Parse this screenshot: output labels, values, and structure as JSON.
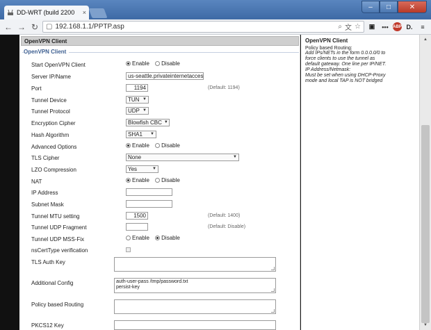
{
  "browser": {
    "tab_title": "DD-WRT (build 2200",
    "tab_close": "×",
    "url": "192.168.⁲1.1/PPTP.asp",
    "back": "←",
    "forward": "→",
    "reload": "↻",
    "win_min": "–",
    "win_max": "□",
    "win_close": "✕",
    "ext_abp": "ABP",
    "ext_d": "D.",
    "menu": "≡"
  },
  "section": {
    "header": "OpenVPN Client",
    "legend": "OpenVPN Client"
  },
  "fields": {
    "start": {
      "label": "Start OpenVPN Client",
      "opt1": "Enable",
      "opt2": "Disable",
      "selected": "Enable"
    },
    "server": {
      "label": "Server IP/Name",
      "value": "us-seattle.privateinternetaccess.c"
    },
    "port": {
      "label": "Port",
      "value": "1194",
      "hint": "(Default: 1194)"
    },
    "tunnel_device": {
      "label": "Tunnel Device",
      "value": "TUN"
    },
    "tunnel_protocol": {
      "label": "Tunnel Protocol",
      "value": "UDP"
    },
    "cipher": {
      "label": "Encryption Cipher",
      "value": "Blowfish CBC"
    },
    "hash": {
      "label": "Hash Algorithm",
      "value": "SHA1"
    },
    "advanced": {
      "label": "Advanced Options",
      "opt1": "Enable",
      "opt2": "Disable",
      "selected": "Enable"
    },
    "tls_cipher": {
      "label": "TLS Cipher",
      "value": "None"
    },
    "lzo": {
      "label": "LZO Compression",
      "value": "Yes"
    },
    "nat": {
      "label": "NAT",
      "opt1": "Enable",
      "opt2": "Disable",
      "selected": "Enable"
    },
    "ip": {
      "label": "IP Address",
      "value": ""
    },
    "subnet": {
      "label": "Subnet Mask",
      "value": ""
    },
    "mtu": {
      "label": "Tunnel MTU setting",
      "value": "1500",
      "hint": "(Default: 1400)"
    },
    "fragment": {
      "label": "Tunnel UDP Fragment",
      "value": "",
      "hint": "(Default: Disable)"
    },
    "mssfix": {
      "label": "Tunnel UDP MSS-Fix",
      "opt1": "Enable",
      "opt2": "Disable",
      "selected": "Disable"
    },
    "nscert": {
      "label": "nsCertType verification"
    },
    "tls_auth": {
      "label": "TLS Auth Key",
      "value": ""
    },
    "additional": {
      "label": "Additional Config",
      "line1": "auth-user-pass /tmp/password.txt",
      "line2": "persist-key"
    },
    "policy": {
      "label": "Policy based Routing",
      "value": ""
    },
    "pkcs12": {
      "label": "PKCS12 Key",
      "value": ""
    }
  },
  "help": {
    "title": "OpenVPN Client",
    "subtitle": "Policy based Routing:",
    "line1": "Add IPs/NETs in the form 0.0.0.0/0 to",
    "line2": "force clients to use the tunnel as",
    "line3": "default gateway. One line per IP/NET.",
    "line4": "IP Address/Netmask:",
    "line5": "Must be set when using DHCP-Proxy",
    "line6": "mode and local TAP is NOT bridged"
  },
  "scroll": {
    "up": "▲",
    "down": "▼"
  }
}
